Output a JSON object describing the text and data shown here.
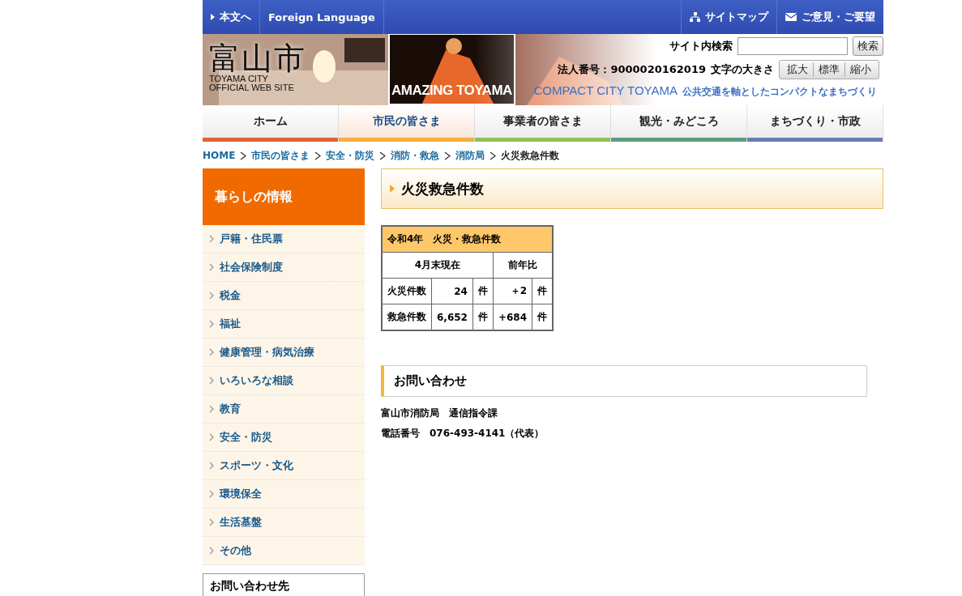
{
  "top_bar": {
    "left_links": [
      {
        "label": "本文へ",
        "kind": "skip"
      },
      {
        "label": "Foreign Language",
        "kind": "plain"
      }
    ],
    "right_links": [
      {
        "label": "サイトマップ",
        "kind": "sitemap"
      },
      {
        "label": "ご意見・ご要望",
        "kind": "mail"
      }
    ]
  },
  "banner": {
    "logo": "富山市",
    "logo_sub": [
      "TOYAMA CITY",
      "OFFICIAL WEB SITE"
    ],
    "campaign": "AMAZING TOYAMA",
    "search": {
      "label": "サイト内検索",
      "button": "検索"
    },
    "corporate_number": "法人番号：9000020162019",
    "text_size": {
      "label": "文字の大きさ",
      "buttons": [
        "拡大",
        "標準",
        "縮小"
      ]
    },
    "slogan_en": "COMPACT CITY TOYAMA",
    "slogan": "公共交通を軸としたコンパクトなまちづくり"
  },
  "nav": [
    {
      "label": "ホーム",
      "selected": false,
      "color": "#e0633a"
    },
    {
      "label": "市民の皆さま",
      "selected": true,
      "color": "#f2b13a"
    },
    {
      "label": "事業者の皆さま",
      "selected": false,
      "color": "#8fc15a"
    },
    {
      "label": "観光・みどころ",
      "selected": false,
      "color": "#5e9e80"
    },
    {
      "label": "まちづくり・市政",
      "selected": false,
      "color": "#6a7fb0"
    }
  ],
  "breadcrumb": [
    "HOME",
    "市民の皆さま",
    "安全・防災",
    "消防・救急",
    "消防局",
    "火災救急件数"
  ],
  "sidebar": {
    "title": "暮らしの情報",
    "items": [
      "戸籍・住民票",
      "社会保険制度",
      "税金",
      "福祉",
      "健康管理・病気治療",
      "いろいろな相談",
      "教育",
      "安全・防災",
      "スポーツ・文化",
      "環境保全",
      "生活基盤",
      "その他"
    ],
    "contact_title": "お問い合わせ先"
  },
  "page_title": "火災救急件数",
  "table": {
    "caption": "令和4年　火災・救急件数",
    "header": [
      "4月末現在",
      "前年比"
    ],
    "rows": [
      {
        "label": "火災件数",
        "count": "24",
        "unit": "件",
        "diff": "＋2",
        "diff_unit": "件"
      },
      {
        "label": "救急件数",
        "count": "6,652",
        "unit": "件",
        "diff": "+684",
        "diff_unit": "件"
      }
    ]
  },
  "contact": {
    "heading": "お問い合わせ",
    "lines": [
      "富山市消防局　通信指令課",
      "電話番号　076-493-4141（代表）"
    ]
  }
}
